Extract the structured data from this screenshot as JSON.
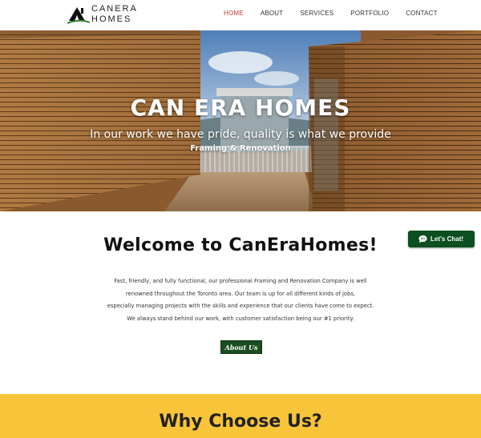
{
  "brand": {
    "line1": "CANERA",
    "line2": "HOMES",
    "accent": "#2e7d32"
  },
  "nav": {
    "items": [
      {
        "label": "HOME",
        "active": true
      },
      {
        "label": "ABOUT"
      },
      {
        "label": "SERVICES"
      },
      {
        "label": "PORTFOLIO"
      },
      {
        "label": "CONTACT"
      }
    ],
    "active_color": "#c0392b"
  },
  "hero": {
    "title": "CAN ERA HOMES",
    "subtitle": "In our work we have pride, quality is what we provide",
    "tagline": "Framing & Renovation"
  },
  "welcome": {
    "title": "Welcome to CanEraHomes!",
    "lines": [
      "Fast, friendly, and fully functional, our professional Framing and Renovation Company is well",
      "renowned throughout the Toronto area. Our team is up for all different kinds of jobs,",
      "especially managing projects with the skills and experience that our clients have come to expect.",
      "We always stand behind our work, with customer satisfaction being our #1 priority."
    ],
    "button_label": "About Us",
    "button_color": "#1a4d1f"
  },
  "chat": {
    "label": "Let's Chat!",
    "icon": "chat-bubble-icon",
    "color": "#0c4f20"
  },
  "why": {
    "title": "Why Choose Us?",
    "background": "#f8c53a"
  }
}
